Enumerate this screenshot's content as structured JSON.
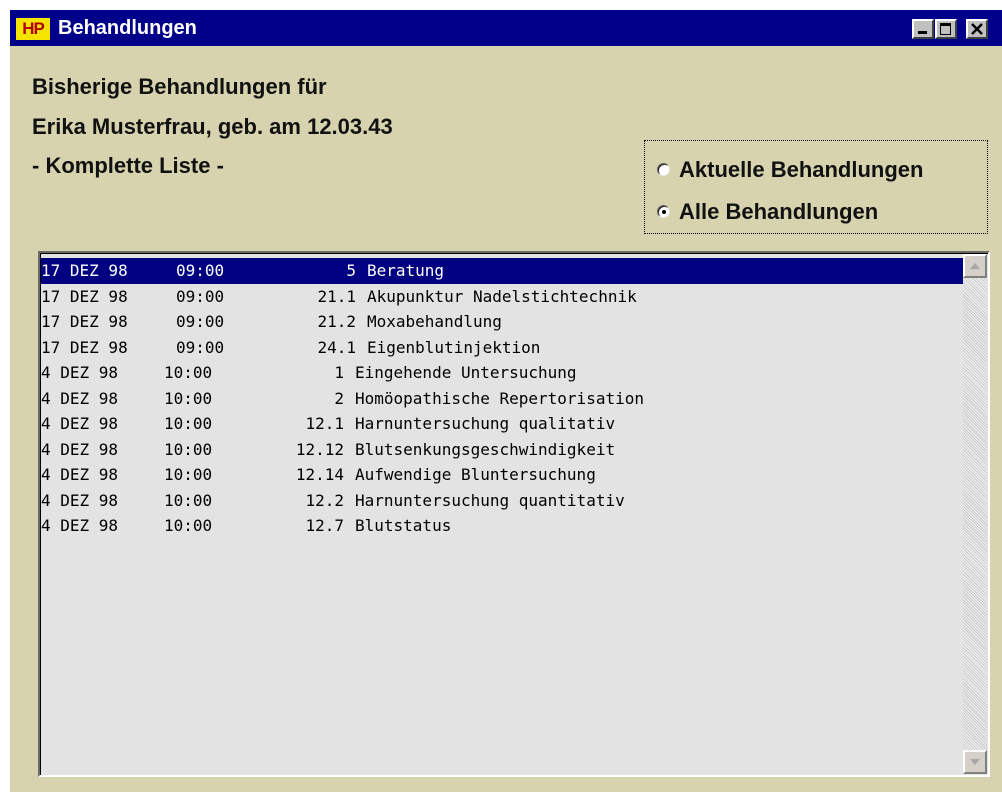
{
  "window": {
    "app_icon_text": "HP",
    "title": "Behandlungen"
  },
  "header": {
    "line1": "Bisherige Behandlungen für",
    "line2": "Erika Musterfrau, geb. am 12.03.43",
    "line3": "- Komplette Liste -"
  },
  "filter": {
    "options": [
      {
        "label": "Aktuelle Behandlungen",
        "selected": false
      },
      {
        "label": "Alle Behandlungen",
        "selected": true
      }
    ]
  },
  "treatments": [
    {
      "date": "17 DEZ 98",
      "time": "09:00",
      "code": "5",
      "description": "Beratung",
      "selected": true
    },
    {
      "date": "17 DEZ 98",
      "time": "09:00",
      "code": "21.1",
      "description": "Akupunktur Nadelstichtechnik",
      "selected": false
    },
    {
      "date": "17 DEZ 98",
      "time": "09:00",
      "code": "21.2",
      "description": "Moxabehandlung",
      "selected": false
    },
    {
      "date": "17 DEZ 98",
      "time": "09:00",
      "code": "24.1",
      "description": "Eigenblutinjektion",
      "selected": false
    },
    {
      "date": "4 DEZ 98",
      "time": "10:00",
      "code": "1",
      "description": "Eingehende Untersuchung",
      "selected": false
    },
    {
      "date": "4 DEZ 98",
      "time": "10:00",
      "code": "2",
      "description": "Homöopathische Repertorisation",
      "selected": false
    },
    {
      "date": "4 DEZ 98",
      "time": "10:00",
      "code": "12.1",
      "description": "Harnuntersuchung qualitativ",
      "selected": false
    },
    {
      "date": "4 DEZ 98",
      "time": "10:00",
      "code": "12.12",
      "description": "Blutsenkungsgeschwindigkeit",
      "selected": false
    },
    {
      "date": "4 DEZ 98",
      "time": "10:00",
      "code": "12.14",
      "description": "Aufwendige Bluntersuchung",
      "selected": false
    },
    {
      "date": "4 DEZ 98",
      "time": "10:00",
      "code": "12.2",
      "description": "Harnuntersuchung quantitativ",
      "selected": false
    },
    {
      "date": "4 DEZ 98",
      "time": "10:00",
      "code": "12.7",
      "description": "Blutstatus",
      "selected": false
    }
  ],
  "icons": {
    "app": "hp-logo-icon",
    "minimize": "minimize-icon",
    "maximize": "maximize-icon",
    "close": "close-icon",
    "scroll_up": "arrow-up-icon",
    "scroll_down": "arrow-down-icon"
  },
  "colors": {
    "titlebar": "#00008b",
    "window_bg": "#d6d3ae",
    "list_bg": "#e3e3e3",
    "selection": "#000080"
  }
}
